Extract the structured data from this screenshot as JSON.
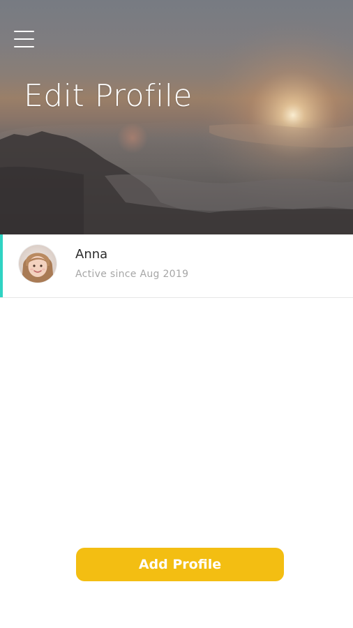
{
  "header": {
    "title": "Edit Profile",
    "menu_icon": "hamburger-menu-icon"
  },
  "profiles": [
    {
      "name": "Anna",
      "subtitle": "Active since Aug 2019",
      "active": true
    }
  ],
  "actions": {
    "add_profile_label": "Add Profile"
  },
  "colors": {
    "accent": "#2fd3c3",
    "button": "#f3be12",
    "name_text": "#2b2b2b",
    "subtitle_text": "#a6a6a6"
  }
}
